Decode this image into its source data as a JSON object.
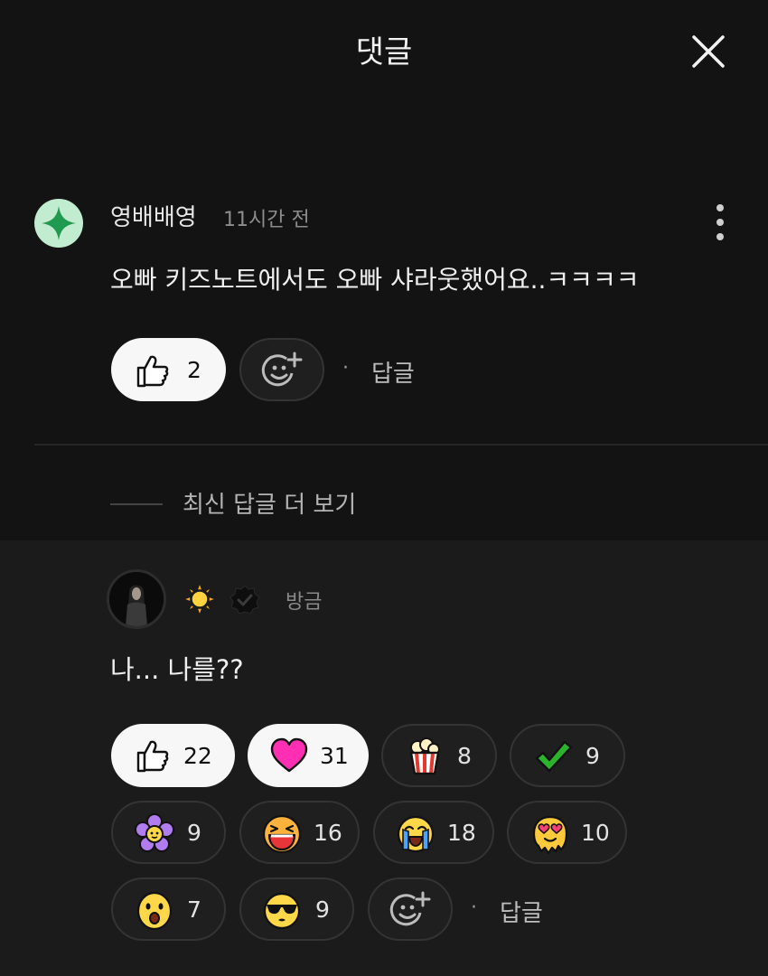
{
  "header": {
    "title": "댓글",
    "close_icon": "close-icon"
  },
  "comment": {
    "author": "영배배영",
    "time": "11시간 전",
    "text": "오빠 키즈노트에서도 오빠 샤라웃했어요..ㅋㅋㅋㅋ",
    "like_count": "2",
    "avatar_color": "#c2ecd0",
    "avatar_icon": "green-sparkle-icon",
    "separator": "·",
    "reply_label": "답글"
  },
  "more_replies_label": "최신 답글 더 보기",
  "reply": {
    "author_emoji": "sun-icon",
    "verified_icon": "verified-badge-icon",
    "time": "방금",
    "text": "나... 나를??",
    "separator": "·",
    "reply_label": "답글",
    "reactions": [
      {
        "icon": "thumbs-up-icon",
        "count": "22",
        "selected": true
      },
      {
        "icon": "heart-icon",
        "count": "31",
        "selected": true
      },
      {
        "icon": "popcorn-icon",
        "count": "8",
        "selected": false
      },
      {
        "icon": "check-icon",
        "count": "9",
        "selected": false
      },
      {
        "icon": "flower-icon",
        "count": "9",
        "selected": false
      },
      {
        "icon": "laughing-face-icon",
        "count": "16",
        "selected": false
      },
      {
        "icon": "crying-face-icon",
        "count": "18",
        "selected": false
      },
      {
        "icon": "heart-eyes-face-icon",
        "count": "10",
        "selected": false
      },
      {
        "icon": "surprised-face-icon",
        "count": "7",
        "selected": false
      },
      {
        "icon": "cool-face-icon",
        "count": "9",
        "selected": false
      }
    ]
  },
  "colors": {
    "background": "#131313",
    "reply_background": "#1b1b1b",
    "pill_selected": "#f7f7f7",
    "pill_dark": "#1f1f1f"
  }
}
